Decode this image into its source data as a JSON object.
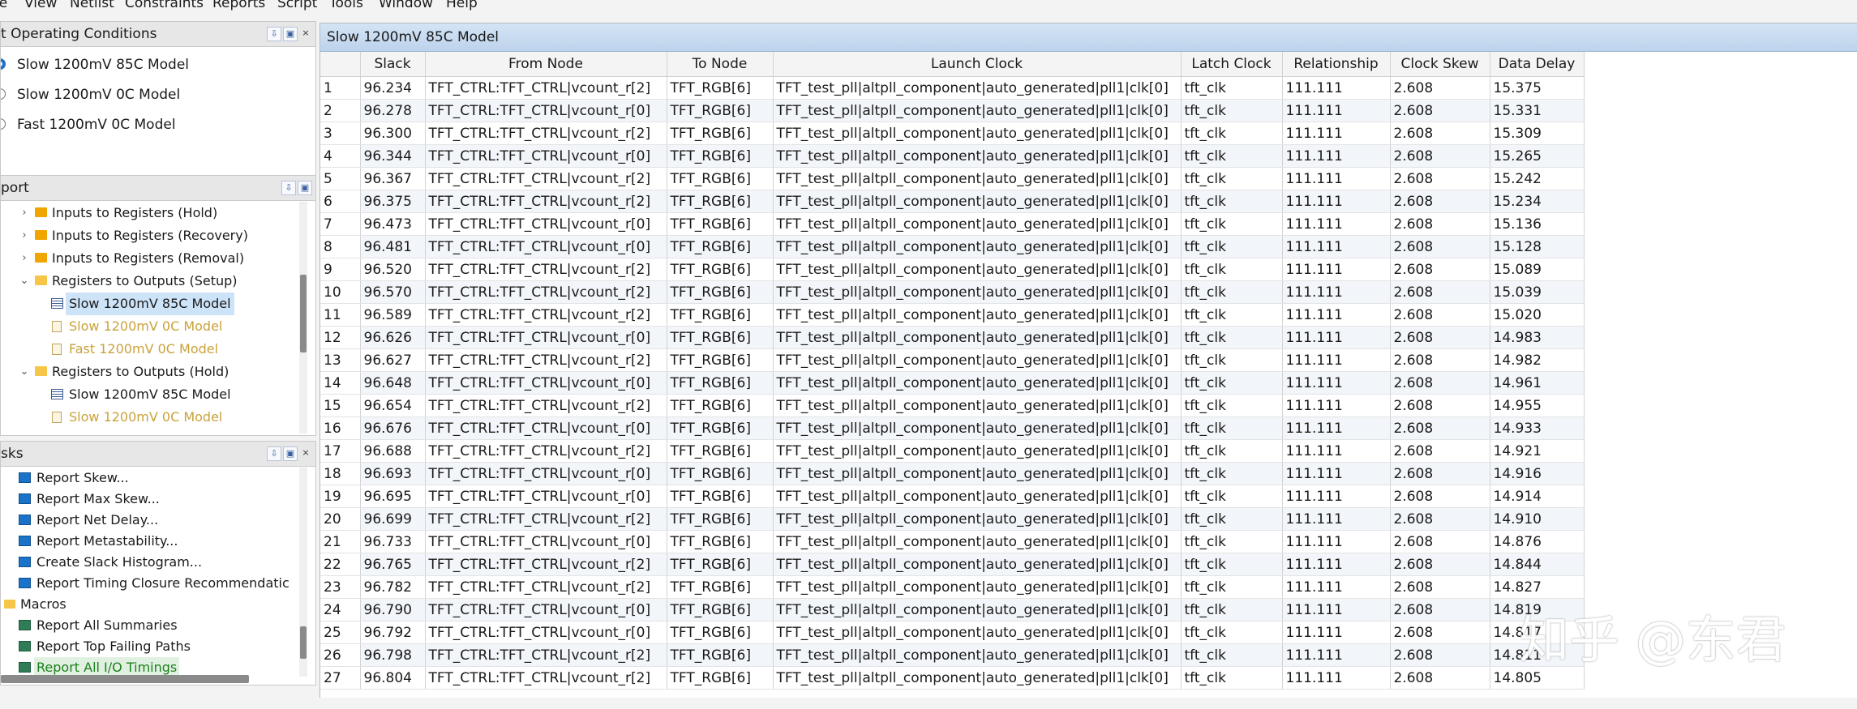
{
  "menubar": [
    "le",
    "View",
    "Netlist",
    "Constraints",
    "Reports",
    "Script",
    "Tools",
    "Window",
    "Help"
  ],
  "conditions_panel": {
    "title": "t Operating Conditions",
    "options": [
      "Slow 1200mV 85C Model",
      "Slow 1200mV 0C Model",
      "Fast 1200mV 0C Model"
    ],
    "selected": "Slow 1200mV 85C Model"
  },
  "report_panel": {
    "title": "port",
    "items": [
      {
        "label": "Inputs to Registers (Hold)"
      },
      {
        "label": "Inputs to Registers (Recovery)"
      },
      {
        "label": "Inputs to Registers (Removal)"
      },
      {
        "label": "Registers to Outputs (Setup)"
      },
      {
        "label": "Slow 1200mV 85C Model"
      },
      {
        "label": "Slow 1200mV 0C Model"
      },
      {
        "label": "Fast 1200mV 0C Model"
      },
      {
        "label": "Registers to Outputs (Hold)"
      },
      {
        "label": "Slow 1200mV 85C Model"
      },
      {
        "label": "Slow 1200mV 0C Model"
      }
    ]
  },
  "tasks_panel": {
    "title": "sks",
    "items": [
      {
        "label": "Report Skew..."
      },
      {
        "label": "Report Max Skew..."
      },
      {
        "label": "Report Net Delay..."
      },
      {
        "label": "Report Metastability..."
      },
      {
        "label": "Create Slack Histogram..."
      },
      {
        "label": "Report Timing Closure Recommendatic"
      },
      {
        "label": "Macros"
      },
      {
        "label": "Report All Summaries"
      },
      {
        "label": "Report Top Failing Paths"
      },
      {
        "label": "Report All I/O Timings"
      }
    ]
  },
  "report_view": {
    "title": "Slow 1200mV 85C Model",
    "columns": [
      "",
      "Slack",
      "From Node",
      "To Node",
      "Launch Clock",
      "Latch Clock",
      "Relationship",
      "Clock Skew",
      "Data Delay"
    ],
    "rows": [
      [
        "1",
        "96.234",
        "TFT_CTRL:TFT_CTRL|vcount_r[2]",
        "TFT_RGB[6]",
        "TFT_test_pll|altpll_component|auto_generated|pll1|clk[0]",
        "tft_clk",
        "111.111",
        "2.608",
        "15.375"
      ],
      [
        "2",
        "96.278",
        "TFT_CTRL:TFT_CTRL|vcount_r[0]",
        "TFT_RGB[6]",
        "TFT_test_pll|altpll_component|auto_generated|pll1|clk[0]",
        "tft_clk",
        "111.111",
        "2.608",
        "15.331"
      ],
      [
        "3",
        "96.300",
        "TFT_CTRL:TFT_CTRL|vcount_r[2]",
        "TFT_RGB[6]",
        "TFT_test_pll|altpll_component|auto_generated|pll1|clk[0]",
        "tft_clk",
        "111.111",
        "2.608",
        "15.309"
      ],
      [
        "4",
        "96.344",
        "TFT_CTRL:TFT_CTRL|vcount_r[0]",
        "TFT_RGB[6]",
        "TFT_test_pll|altpll_component|auto_generated|pll1|clk[0]",
        "tft_clk",
        "111.111",
        "2.608",
        "15.265"
      ],
      [
        "5",
        "96.367",
        "TFT_CTRL:TFT_CTRL|vcount_r[2]",
        "TFT_RGB[6]",
        "TFT_test_pll|altpll_component|auto_generated|pll1|clk[0]",
        "tft_clk",
        "111.111",
        "2.608",
        "15.242"
      ],
      [
        "6",
        "96.375",
        "TFT_CTRL:TFT_CTRL|vcount_r[2]",
        "TFT_RGB[6]",
        "TFT_test_pll|altpll_component|auto_generated|pll1|clk[0]",
        "tft_clk",
        "111.111",
        "2.608",
        "15.234"
      ],
      [
        "7",
        "96.473",
        "TFT_CTRL:TFT_CTRL|vcount_r[0]",
        "TFT_RGB[6]",
        "TFT_test_pll|altpll_component|auto_generated|pll1|clk[0]",
        "tft_clk",
        "111.111",
        "2.608",
        "15.136"
      ],
      [
        "8",
        "96.481",
        "TFT_CTRL:TFT_CTRL|vcount_r[0]",
        "TFT_RGB[6]",
        "TFT_test_pll|altpll_component|auto_generated|pll1|clk[0]",
        "tft_clk",
        "111.111",
        "2.608",
        "15.128"
      ],
      [
        "9",
        "96.520",
        "TFT_CTRL:TFT_CTRL|vcount_r[2]",
        "TFT_RGB[6]",
        "TFT_test_pll|altpll_component|auto_generated|pll1|clk[0]",
        "tft_clk",
        "111.111",
        "2.608",
        "15.089"
      ],
      [
        "10",
        "96.570",
        "TFT_CTRL:TFT_CTRL|vcount_r[2]",
        "TFT_RGB[6]",
        "TFT_test_pll|altpll_component|auto_generated|pll1|clk[0]",
        "tft_clk",
        "111.111",
        "2.608",
        "15.039"
      ],
      [
        "11",
        "96.589",
        "TFT_CTRL:TFT_CTRL|vcount_r[2]",
        "TFT_RGB[6]",
        "TFT_test_pll|altpll_component|auto_generated|pll1|clk[0]",
        "tft_clk",
        "111.111",
        "2.608",
        "15.020"
      ],
      [
        "12",
        "96.626",
        "TFT_CTRL:TFT_CTRL|vcount_r[0]",
        "TFT_RGB[6]",
        "TFT_test_pll|altpll_component|auto_generated|pll1|clk[0]",
        "tft_clk",
        "111.111",
        "2.608",
        "14.983"
      ],
      [
        "13",
        "96.627",
        "TFT_CTRL:TFT_CTRL|vcount_r[2]",
        "TFT_RGB[6]",
        "TFT_test_pll|altpll_component|auto_generated|pll1|clk[0]",
        "tft_clk",
        "111.111",
        "2.608",
        "14.982"
      ],
      [
        "14",
        "96.648",
        "TFT_CTRL:TFT_CTRL|vcount_r[0]",
        "TFT_RGB[6]",
        "TFT_test_pll|altpll_component|auto_generated|pll1|clk[0]",
        "tft_clk",
        "111.111",
        "2.608",
        "14.961"
      ],
      [
        "15",
        "96.654",
        "TFT_CTRL:TFT_CTRL|vcount_r[2]",
        "TFT_RGB[6]",
        "TFT_test_pll|altpll_component|auto_generated|pll1|clk[0]",
        "tft_clk",
        "111.111",
        "2.608",
        "14.955"
      ],
      [
        "16",
        "96.676",
        "TFT_CTRL:TFT_CTRL|vcount_r[0]",
        "TFT_RGB[6]",
        "TFT_test_pll|altpll_component|auto_generated|pll1|clk[0]",
        "tft_clk",
        "111.111",
        "2.608",
        "14.933"
      ],
      [
        "17",
        "96.688",
        "TFT_CTRL:TFT_CTRL|vcount_r[2]",
        "TFT_RGB[6]",
        "TFT_test_pll|altpll_component|auto_generated|pll1|clk[0]",
        "tft_clk",
        "111.111",
        "2.608",
        "14.921"
      ],
      [
        "18",
        "96.693",
        "TFT_CTRL:TFT_CTRL|vcount_r[0]",
        "TFT_RGB[6]",
        "TFT_test_pll|altpll_component|auto_generated|pll1|clk[0]",
        "tft_clk",
        "111.111",
        "2.608",
        "14.916"
      ],
      [
        "19",
        "96.695",
        "TFT_CTRL:TFT_CTRL|vcount_r[0]",
        "TFT_RGB[6]",
        "TFT_test_pll|altpll_component|auto_generated|pll1|clk[0]",
        "tft_clk",
        "111.111",
        "2.608",
        "14.914"
      ],
      [
        "20",
        "96.699",
        "TFT_CTRL:TFT_CTRL|vcount_r[2]",
        "TFT_RGB[6]",
        "TFT_test_pll|altpll_component|auto_generated|pll1|clk[0]",
        "tft_clk",
        "111.111",
        "2.608",
        "14.910"
      ],
      [
        "21",
        "96.733",
        "TFT_CTRL:TFT_CTRL|vcount_r[0]",
        "TFT_RGB[6]",
        "TFT_test_pll|altpll_component|auto_generated|pll1|clk[0]",
        "tft_clk",
        "111.111",
        "2.608",
        "14.876"
      ],
      [
        "22",
        "96.765",
        "TFT_CTRL:TFT_CTRL|vcount_r[2]",
        "TFT_RGB[6]",
        "TFT_test_pll|altpll_component|auto_generated|pll1|clk[0]",
        "tft_clk",
        "111.111",
        "2.608",
        "14.844"
      ],
      [
        "23",
        "96.782",
        "TFT_CTRL:TFT_CTRL|vcount_r[2]",
        "TFT_RGB[6]",
        "TFT_test_pll|altpll_component|auto_generated|pll1|clk[0]",
        "tft_clk",
        "111.111",
        "2.608",
        "14.827"
      ],
      [
        "24",
        "96.790",
        "TFT_CTRL:TFT_CTRL|vcount_r[0]",
        "TFT_RGB[6]",
        "TFT_test_pll|altpll_component|auto_generated|pll1|clk[0]",
        "tft_clk",
        "111.111",
        "2.608",
        "14.819"
      ],
      [
        "25",
        "96.792",
        "TFT_CTRL:TFT_CTRL|vcount_r[0]",
        "TFT_RGB[6]",
        "TFT_test_pll|altpll_component|auto_generated|pll1|clk[0]",
        "tft_clk",
        "111.111",
        "2.608",
        "14.817"
      ],
      [
        "26",
        "96.798",
        "TFT_CTRL:TFT_CTRL|vcount_r[2]",
        "TFT_RGB[6]",
        "TFT_test_pll|altpll_component|auto_generated|pll1|clk[0]",
        "tft_clk",
        "111.111",
        "2.608",
        "14.811"
      ],
      [
        "27",
        "96.804",
        "TFT_CTRL:TFT_CTRL|vcount_r[2]",
        "TFT_RGB[6]",
        "TFT_test_pll|altpll_component|auto_generated|pll1|clk[0]",
        "tft_clk",
        "111.111",
        "2.608",
        "14.805"
      ]
    ]
  },
  "watermark": "知乎 @东君",
  "colors": {
    "selected_row": "#cde3f8",
    "title_bar": "#c7dbf1",
    "alt_row": "#f2f5f9",
    "dim_text": "#c9a23a",
    "highlight_task": "#1b7f1b"
  }
}
